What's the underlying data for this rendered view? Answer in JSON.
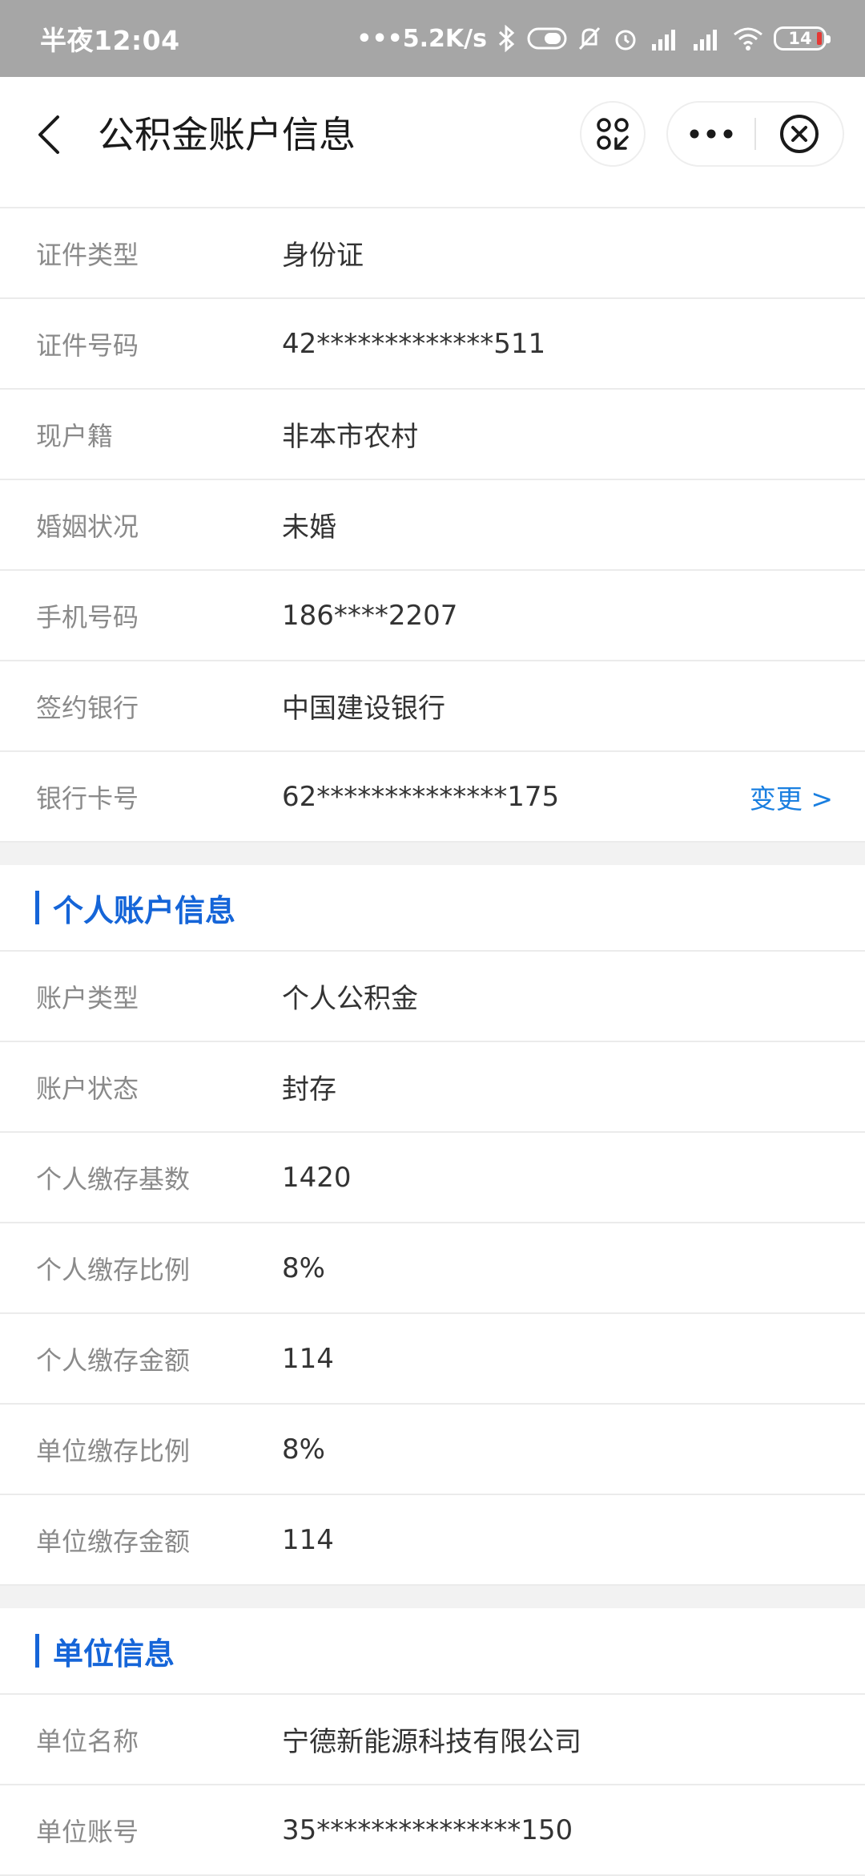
{
  "status_bar": {
    "time": "半夜12:04",
    "network_speed": "•••5.2K/s",
    "battery_level": "14"
  },
  "header": {
    "title": "公积金账户信息"
  },
  "basic_info": [
    {
      "label": "证件类型",
      "value": "身份证"
    },
    {
      "label": "证件号码",
      "value": "42*************511"
    },
    {
      "label": "现户籍",
      "value": "非本市农村"
    },
    {
      "label": "婚姻状况",
      "value": "未婚"
    },
    {
      "label": "手机号码",
      "value": "186****2207"
    },
    {
      "label": "签约银行",
      "value": "中国建设银行"
    },
    {
      "label": "银行卡号",
      "value": "62**************175",
      "action": "变更 >"
    }
  ],
  "personal_section": {
    "title": "个人账户信息",
    "rows": [
      {
        "label": "账户类型",
        "value": "个人公积金"
      },
      {
        "label": "账户状态",
        "value": "封存"
      },
      {
        "label": "个人缴存基数",
        "value": "1420"
      },
      {
        "label": "个人缴存比例",
        "value": "8%"
      },
      {
        "label": "个人缴存金额",
        "value": "114"
      },
      {
        "label": "单位缴存比例",
        "value": "8%"
      },
      {
        "label": "单位缴存金额",
        "value": "114"
      }
    ]
  },
  "company_section": {
    "title": "单位信息",
    "rows": [
      {
        "label": "单位名称",
        "value": "宁德新能源科技有限公司"
      },
      {
        "label": "单位账号",
        "value": "35***************150"
      }
    ]
  },
  "colors": {
    "accent": "#1565d8",
    "link": "#1a7fe0",
    "status_bar": "#a6a6a6"
  }
}
